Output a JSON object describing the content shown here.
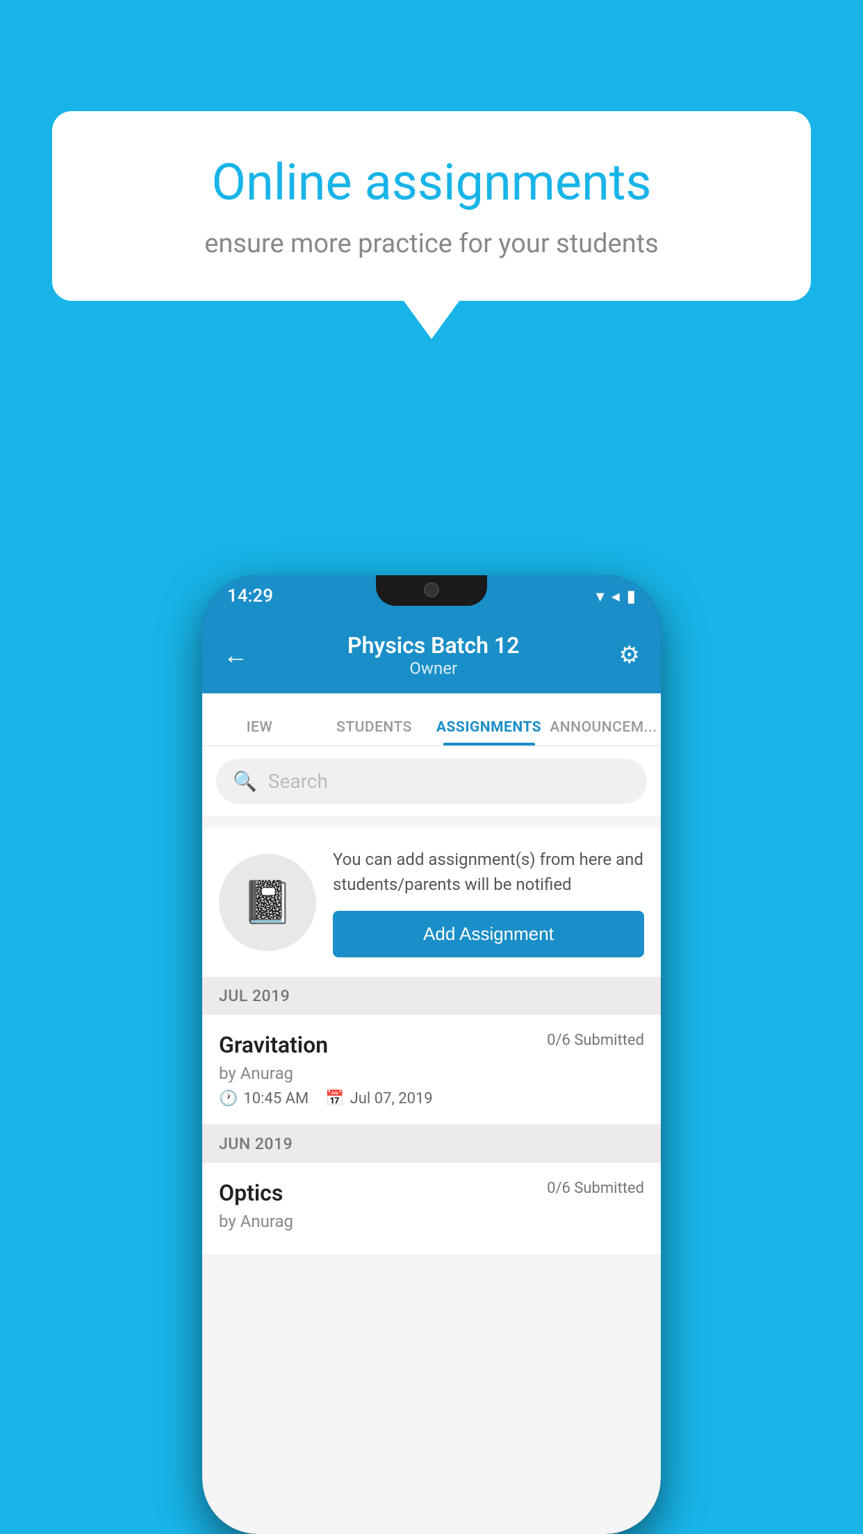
{
  "background": {
    "color": "#18b4e8"
  },
  "speech_bubble": {
    "title": "Online assignments",
    "subtitle": "ensure more practice for your students"
  },
  "phone": {
    "status_bar": {
      "time": "14:29",
      "icons": "▾ ◂ ▮"
    },
    "header": {
      "title": "Physics Batch 12",
      "subtitle": "Owner",
      "back_label": "←",
      "settings_label": "⚙"
    },
    "tabs": [
      {
        "label": "IEW",
        "active": false
      },
      {
        "label": "STUDENTS",
        "active": false
      },
      {
        "label": "ASSIGNMENTS",
        "active": true
      },
      {
        "label": "ANNOUNCEM...",
        "active": false
      }
    ],
    "search": {
      "placeholder": "Search"
    },
    "promo": {
      "text": "You can add assignment(s) from here and students/parents will be notified",
      "button_label": "Add Assignment"
    },
    "sections": [
      {
        "month": "JUL 2019",
        "assignments": [
          {
            "name": "Gravitation",
            "submitted": "0/6 Submitted",
            "by": "by Anurag",
            "time": "10:45 AM",
            "date": "Jul 07, 2019"
          }
        ]
      },
      {
        "month": "JUN 2019",
        "assignments": [
          {
            "name": "Optics",
            "submitted": "0/6 Submitted",
            "by": "by Anurag",
            "time": "",
            "date": ""
          }
        ]
      }
    ]
  }
}
